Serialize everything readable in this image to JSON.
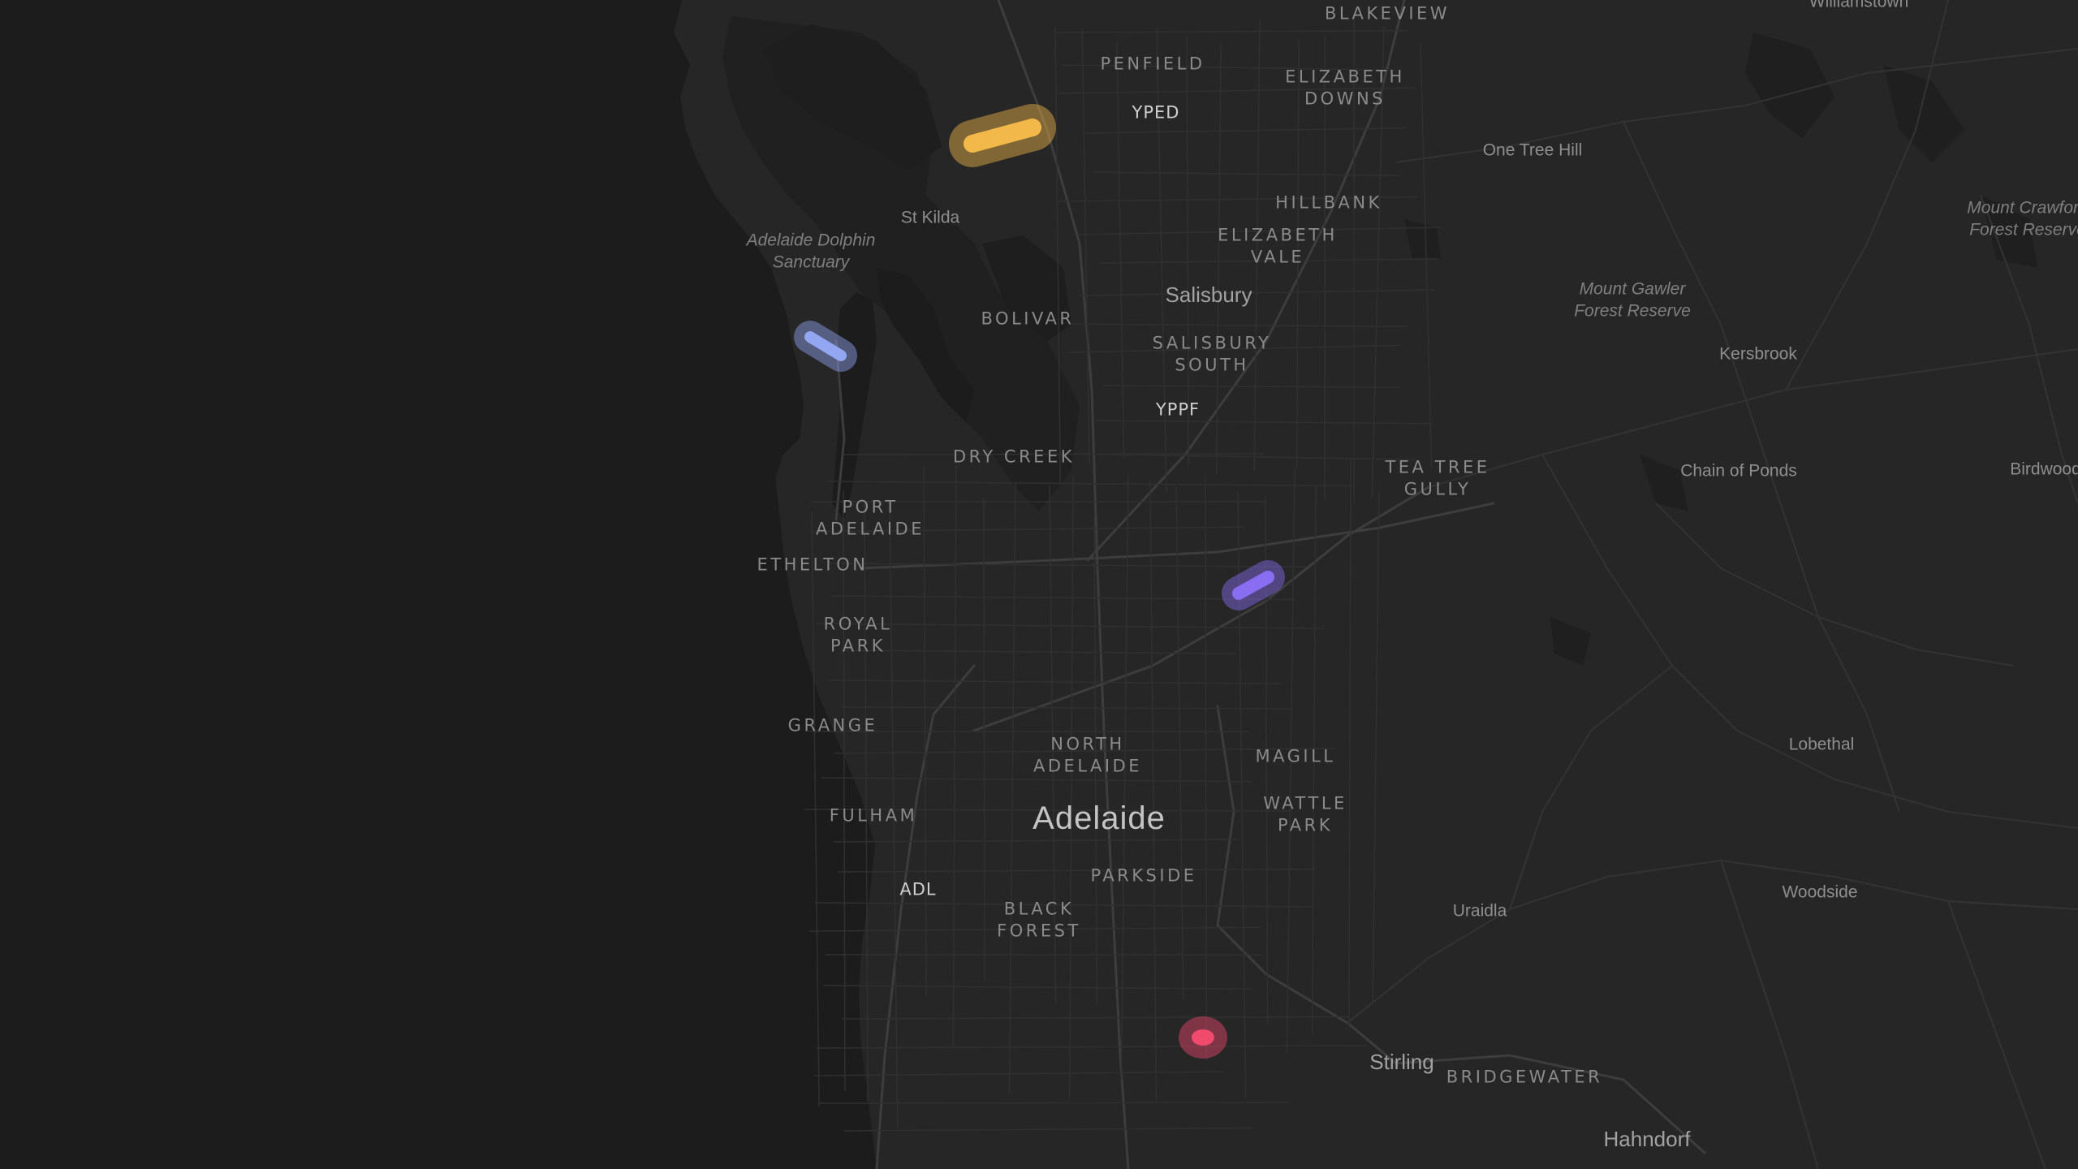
{
  "map": {
    "labels": {
      "blakeview": "BLAKEVIEW",
      "williamstown": "Williamstown",
      "penfield": "PENFIELD",
      "elizabeth_downs": "ELIZABETH\nDOWNS",
      "yped": "YPED",
      "one_tree_hill": "One Tree Hill",
      "st_kilda": "St Kilda",
      "hillbank": "HILLBANK",
      "mount_crawford": "Mount Crawford\nForest Reserve",
      "dolphin_sanctuary": "Adelaide Dolphin\nSanctuary",
      "elizabeth_vale": "ELIZABETH\nVALE",
      "salisbury": "Salisbury",
      "mount_gawler": "Mount Gawler\nForest Reserve",
      "bolivar": "BOLIVAR",
      "salisbury_south": "SALISBURY\nSOUTH",
      "kersbrook": "Kersbrook",
      "yppf": "YPPF",
      "dry_creek": "DRY CREEK",
      "tea_tree_gully": "TEA TREE\nGULLY",
      "chain_of_ponds": "Chain of Ponds",
      "birdwood": "Birdwood",
      "port_adelaide": "PORT\nADELAIDE",
      "ethelton": "ETHELTON",
      "royal_park": "ROYAL\nPARK",
      "grange": "GRANGE",
      "north_adelaide": "NORTH\nADELAIDE",
      "magill": "MAGILL",
      "lobethal": "Lobethal",
      "fulham": "FULHAM",
      "adelaide": "Adelaide",
      "wattle_park": "WATTLE\nPARK",
      "parkside": "PARKSIDE",
      "adl": "ADL",
      "woodside": "Woodside",
      "black_forest": "BLACK\nFOREST",
      "uraidla": "Uraidla",
      "stirling": "Stirling",
      "bridgewater": "BRIDGEWATER",
      "hahndorf": "Hahndorf"
    },
    "markers": [
      {
        "id": "yellow",
        "color": "#f2b94a"
      },
      {
        "id": "blue",
        "color": "#93a6f2"
      },
      {
        "id": "purple",
        "color": "#8a6ef2"
      },
      {
        "id": "red",
        "color": "#f04a6c"
      }
    ]
  }
}
